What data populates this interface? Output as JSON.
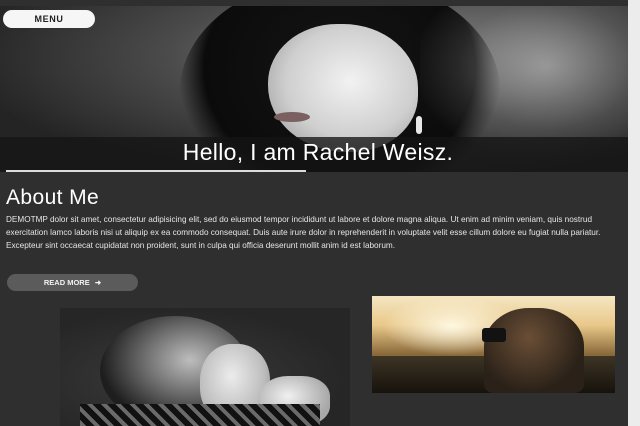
{
  "nav": {
    "menu_label": "MENU"
  },
  "hero": {
    "title": "Hello, I am Rachel Weisz."
  },
  "about": {
    "heading": "About Me",
    "paragraph": "DEMOTMP dolor sit amet, consectetur adipisicing elit, sed do eiusmod tempor incididunt ut labore et dolore magna aliqua. Ut enim ad minim veniam, quis nostrud exercitation lamco laboris nisi ut aliquip ex ea commodo consequat. Duis aute irure dolor in reprehenderit in voluptate velit esse cillum dolore eu fugiat nulla pariatur. Excepteur sint occaecat cupidatat non proident, sunt in culpa qui officia deserunt mollit anim id est laborum.",
    "read_more_label": "READ MORE",
    "read_more_icon": "arrow-right-icon"
  },
  "colors": {
    "background": "#2f2f2f",
    "button_light": "#f6f6f6",
    "button_dark": "#5b5b5b"
  }
}
